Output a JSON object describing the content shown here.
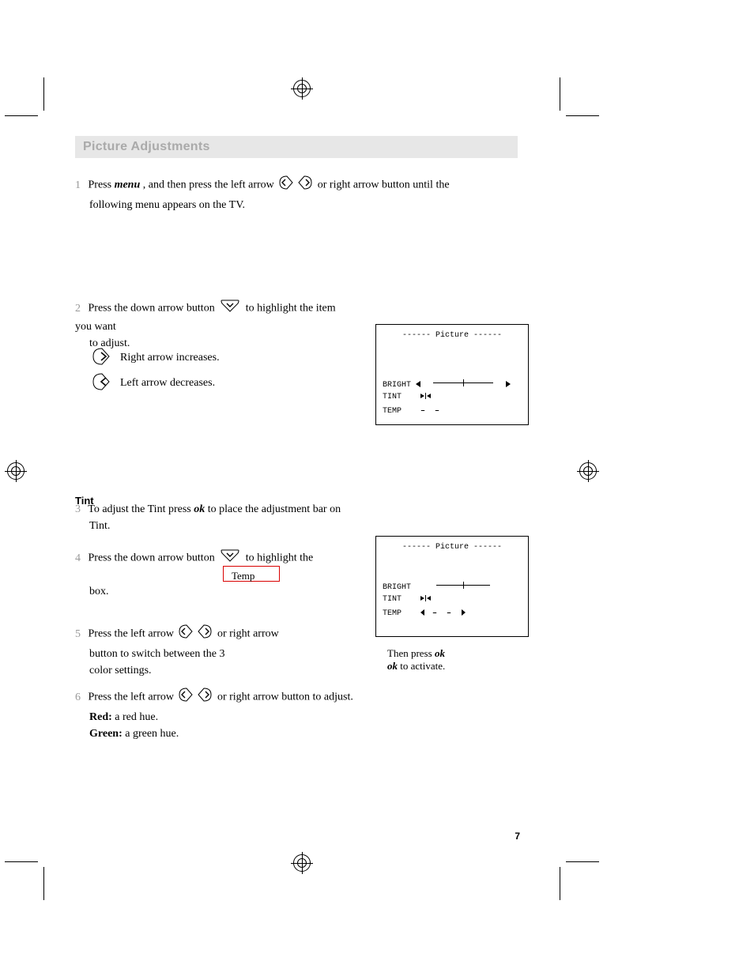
{
  "heading": "Picture Adjustments",
  "step1": {
    "num": "1",
    "pre": "Press",
    "menu": "menu",
    "mid": ", and then press the left arrow",
    "tail": "or right arrow button until the",
    "line2": "following menu appears on the TV."
  },
  "step2": {
    "num": "2",
    "line1a": "Press the down arrow button",
    "line1b": "to highlight the item you want",
    "line2": "to adjust.",
    "right_label": "Right arrow",
    "right_desc": "increases. ",
    "left_label": "Left arrow",
    "left_desc": "decreases. "
  },
  "tint_heading": "Tint",
  "step3": {
    "num": "3",
    "line1": "To adjust the Tint press",
    "ok1": "ok",
    "mid": "to place the adjustment bar on",
    "line2": "Tint."
  },
  "step4": {
    "num": "4",
    "line1a": "Press the down arrow button",
    "line1b": "to highlight the",
    "redword": "Temp",
    "line2": "box."
  },
  "step5": {
    "num": "5",
    "line1": "Press the left arrow",
    "mid": "or right arrow",
    "tail": "button to switch between the 3",
    "line2": "color settings.",
    "okpost": "ok",
    "okpost_text": "to activate."
  },
  "step6": {
    "num": "6",
    "line1": "Press the left arrow",
    "mid": "or right arrow",
    "tail": "button to adjust.",
    "redlabel": "Red:",
    "redtext": " a red hue.",
    "greenlabel": "Green:",
    "greentext": " a green hue."
  },
  "osd1": {
    "title": "------ Picture ------",
    "bright": "BRIGHT",
    "tint": "TINT",
    "temp": "TEMP"
  },
  "osd2": {
    "title": "------ Picture ------",
    "bright": "BRIGHT",
    "tint": "TINT",
    "temp": "TEMP"
  },
  "osd2_caption_pre": "Then press",
  "osd2_caption_ok": "ok",
  "page_number": "7"
}
